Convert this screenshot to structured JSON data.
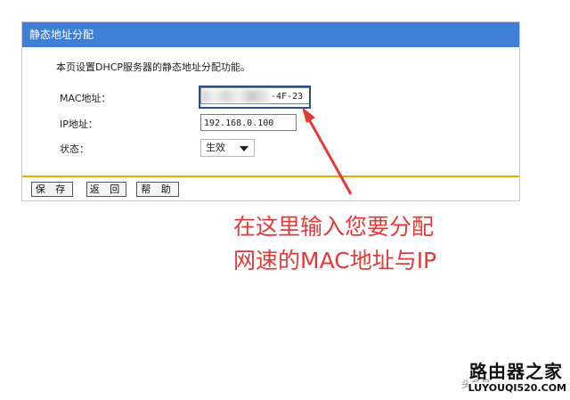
{
  "panel": {
    "title": "静态地址分配",
    "description": "本页设置DHCP服务器的静态地址分配功能。"
  },
  "form": {
    "mac_label": "MAC地址：",
    "mac_value_visible": "-4F-23",
    "ip_label": "IP地址：",
    "ip_value": "192.168.0.100",
    "status_label": "状态：",
    "status_value": "生效"
  },
  "buttons": {
    "save": "保 存",
    "back": "返 回",
    "help": "帮 助"
  },
  "annotation": {
    "text": "在这里输入您要分配\n网速的MAC地址与IP"
  },
  "watermark": {
    "title": "路由器之家",
    "url": "LUYOUQI520.COM",
    "faint": "头条号"
  },
  "colors": {
    "header_bg": "#3f7fd8",
    "accent_line": "#f0a800",
    "annotation": "#e03a3a"
  }
}
